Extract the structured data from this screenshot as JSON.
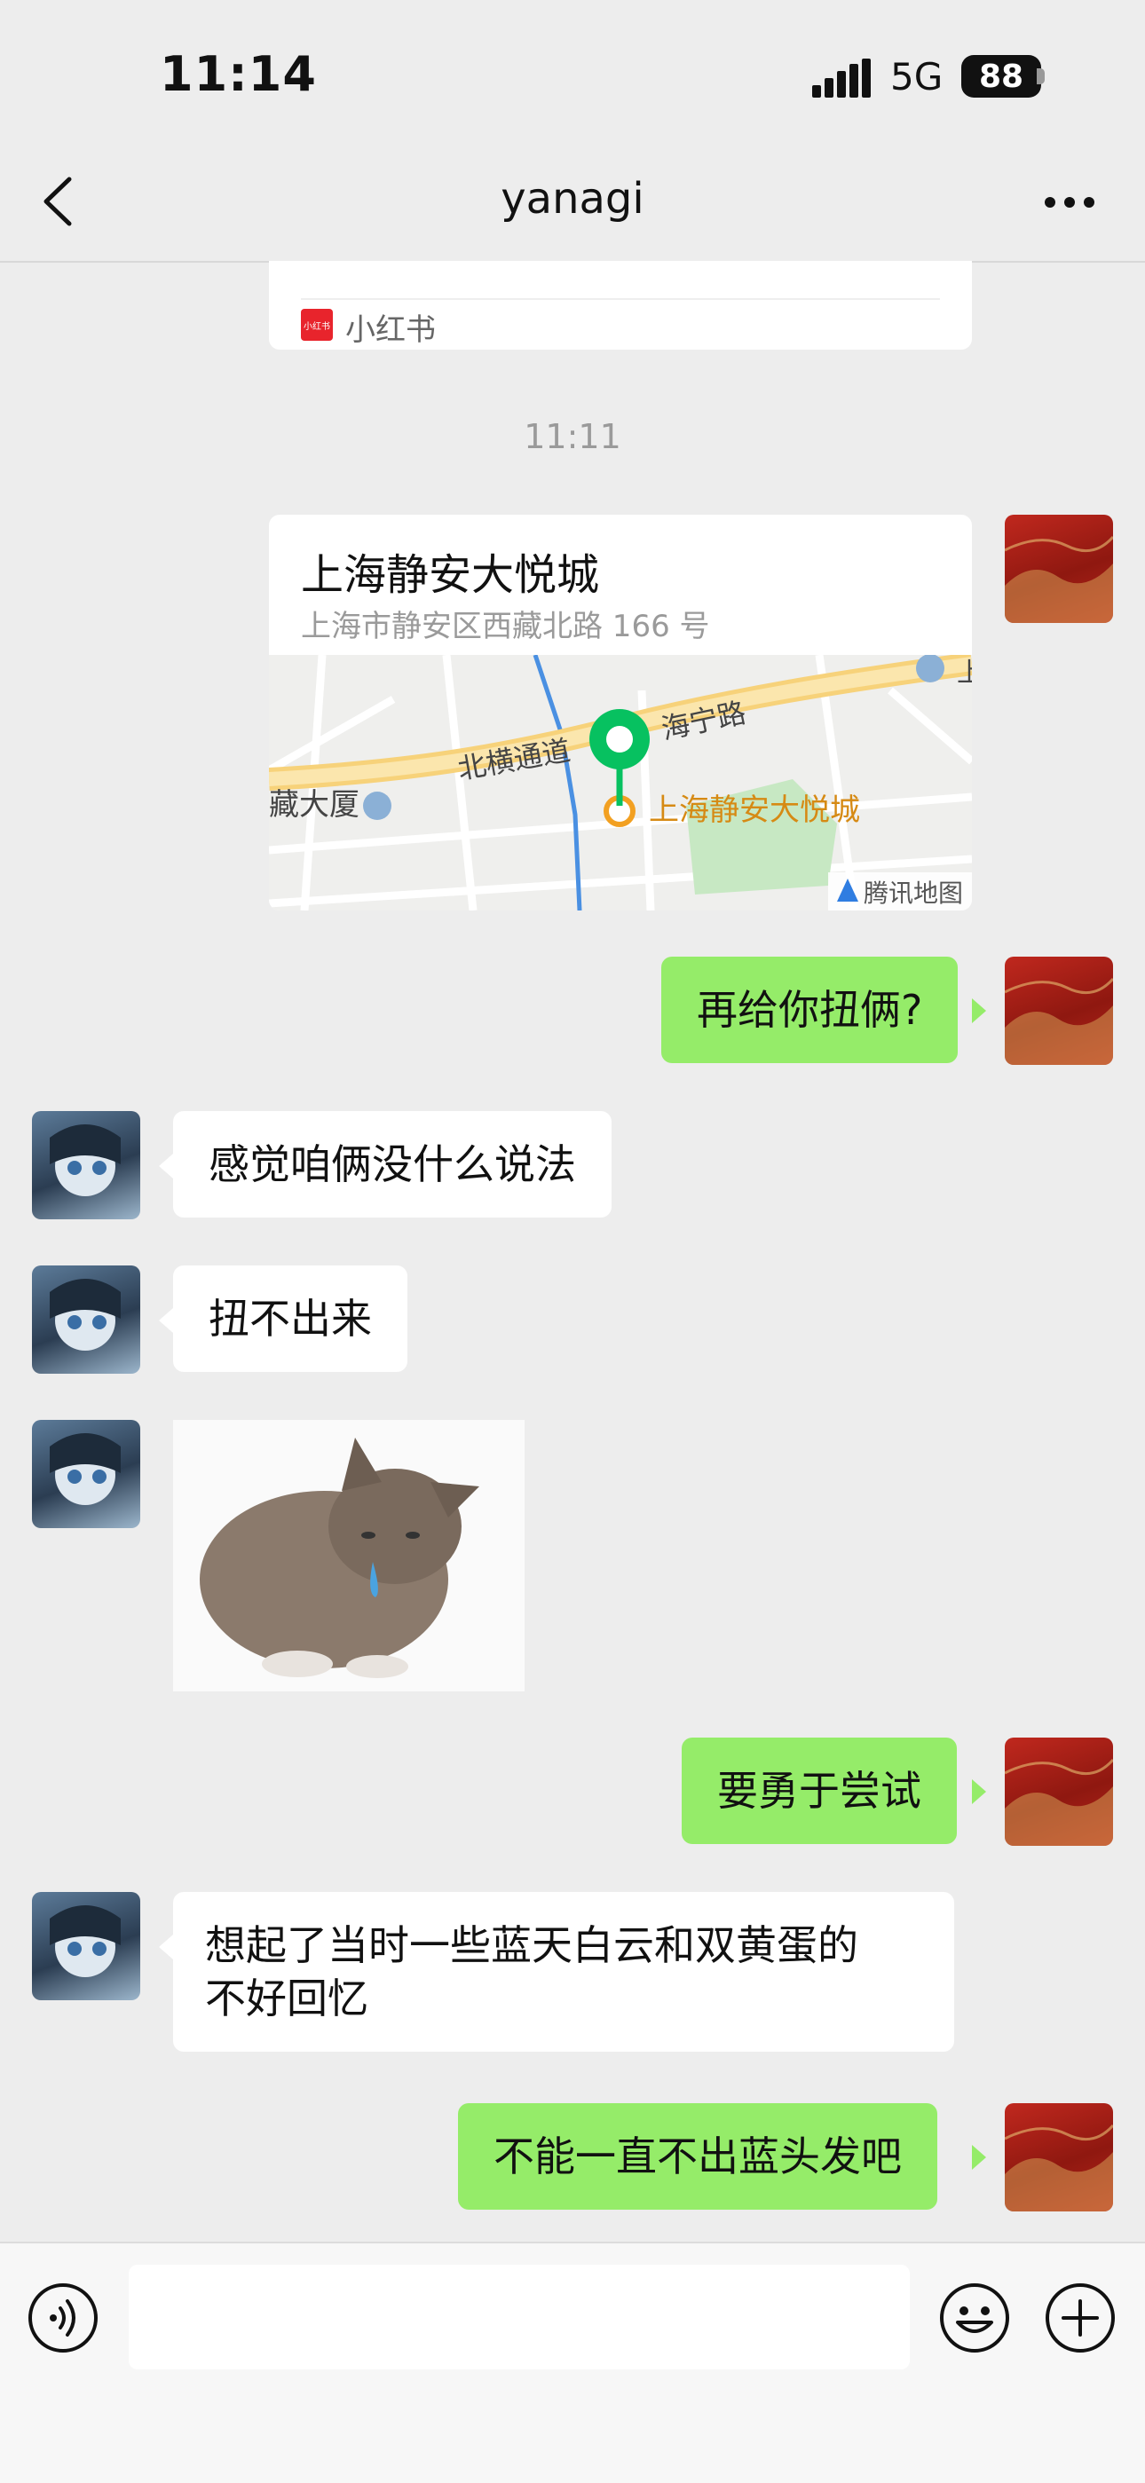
{
  "status_bar": {
    "time": "11:14",
    "network": "5G",
    "battery": "88"
  },
  "nav": {
    "title": "yanagi"
  },
  "shared_card": {
    "source": "小红书",
    "source_logo": "小红书"
  },
  "timestamp": "11:11",
  "location": {
    "name": "上海静安大悦城",
    "address": "上海市静安区西藏北路 166 号",
    "map_labels": {
      "road1": "北横通道",
      "road2": "海宁路",
      "poi": "上海静安大悦城",
      "poi_left": "藏大厦",
      "edge_char": "上",
      "map_brand": "腾讯地图"
    }
  },
  "messages": [
    {
      "side": "right",
      "text": "再给你扭俩?"
    },
    {
      "side": "left",
      "text": "感觉咱俩没什么说法"
    },
    {
      "side": "left",
      "text": "扭不出来"
    },
    {
      "side": "left",
      "type": "sticker",
      "icon": "kitten-crying-sticker"
    },
    {
      "side": "right",
      "text": "要勇于尝试"
    },
    {
      "side": "left",
      "text_line1": "想起了当时一些蓝天白云和双黄蛋的",
      "text_line2": "不好回忆"
    },
    {
      "side": "right",
      "text": "不能一直不出蓝头发吧"
    }
  ],
  "input": {
    "placeholder": ""
  },
  "colors": {
    "background": "#ededed",
    "self_bubble": "#95ec69",
    "other_bubble": "#ffffff",
    "map_pin": "#07c160"
  },
  "icons": [
    "back-icon",
    "more-icon",
    "voice-icon",
    "emoji-icon",
    "add-icon"
  ]
}
